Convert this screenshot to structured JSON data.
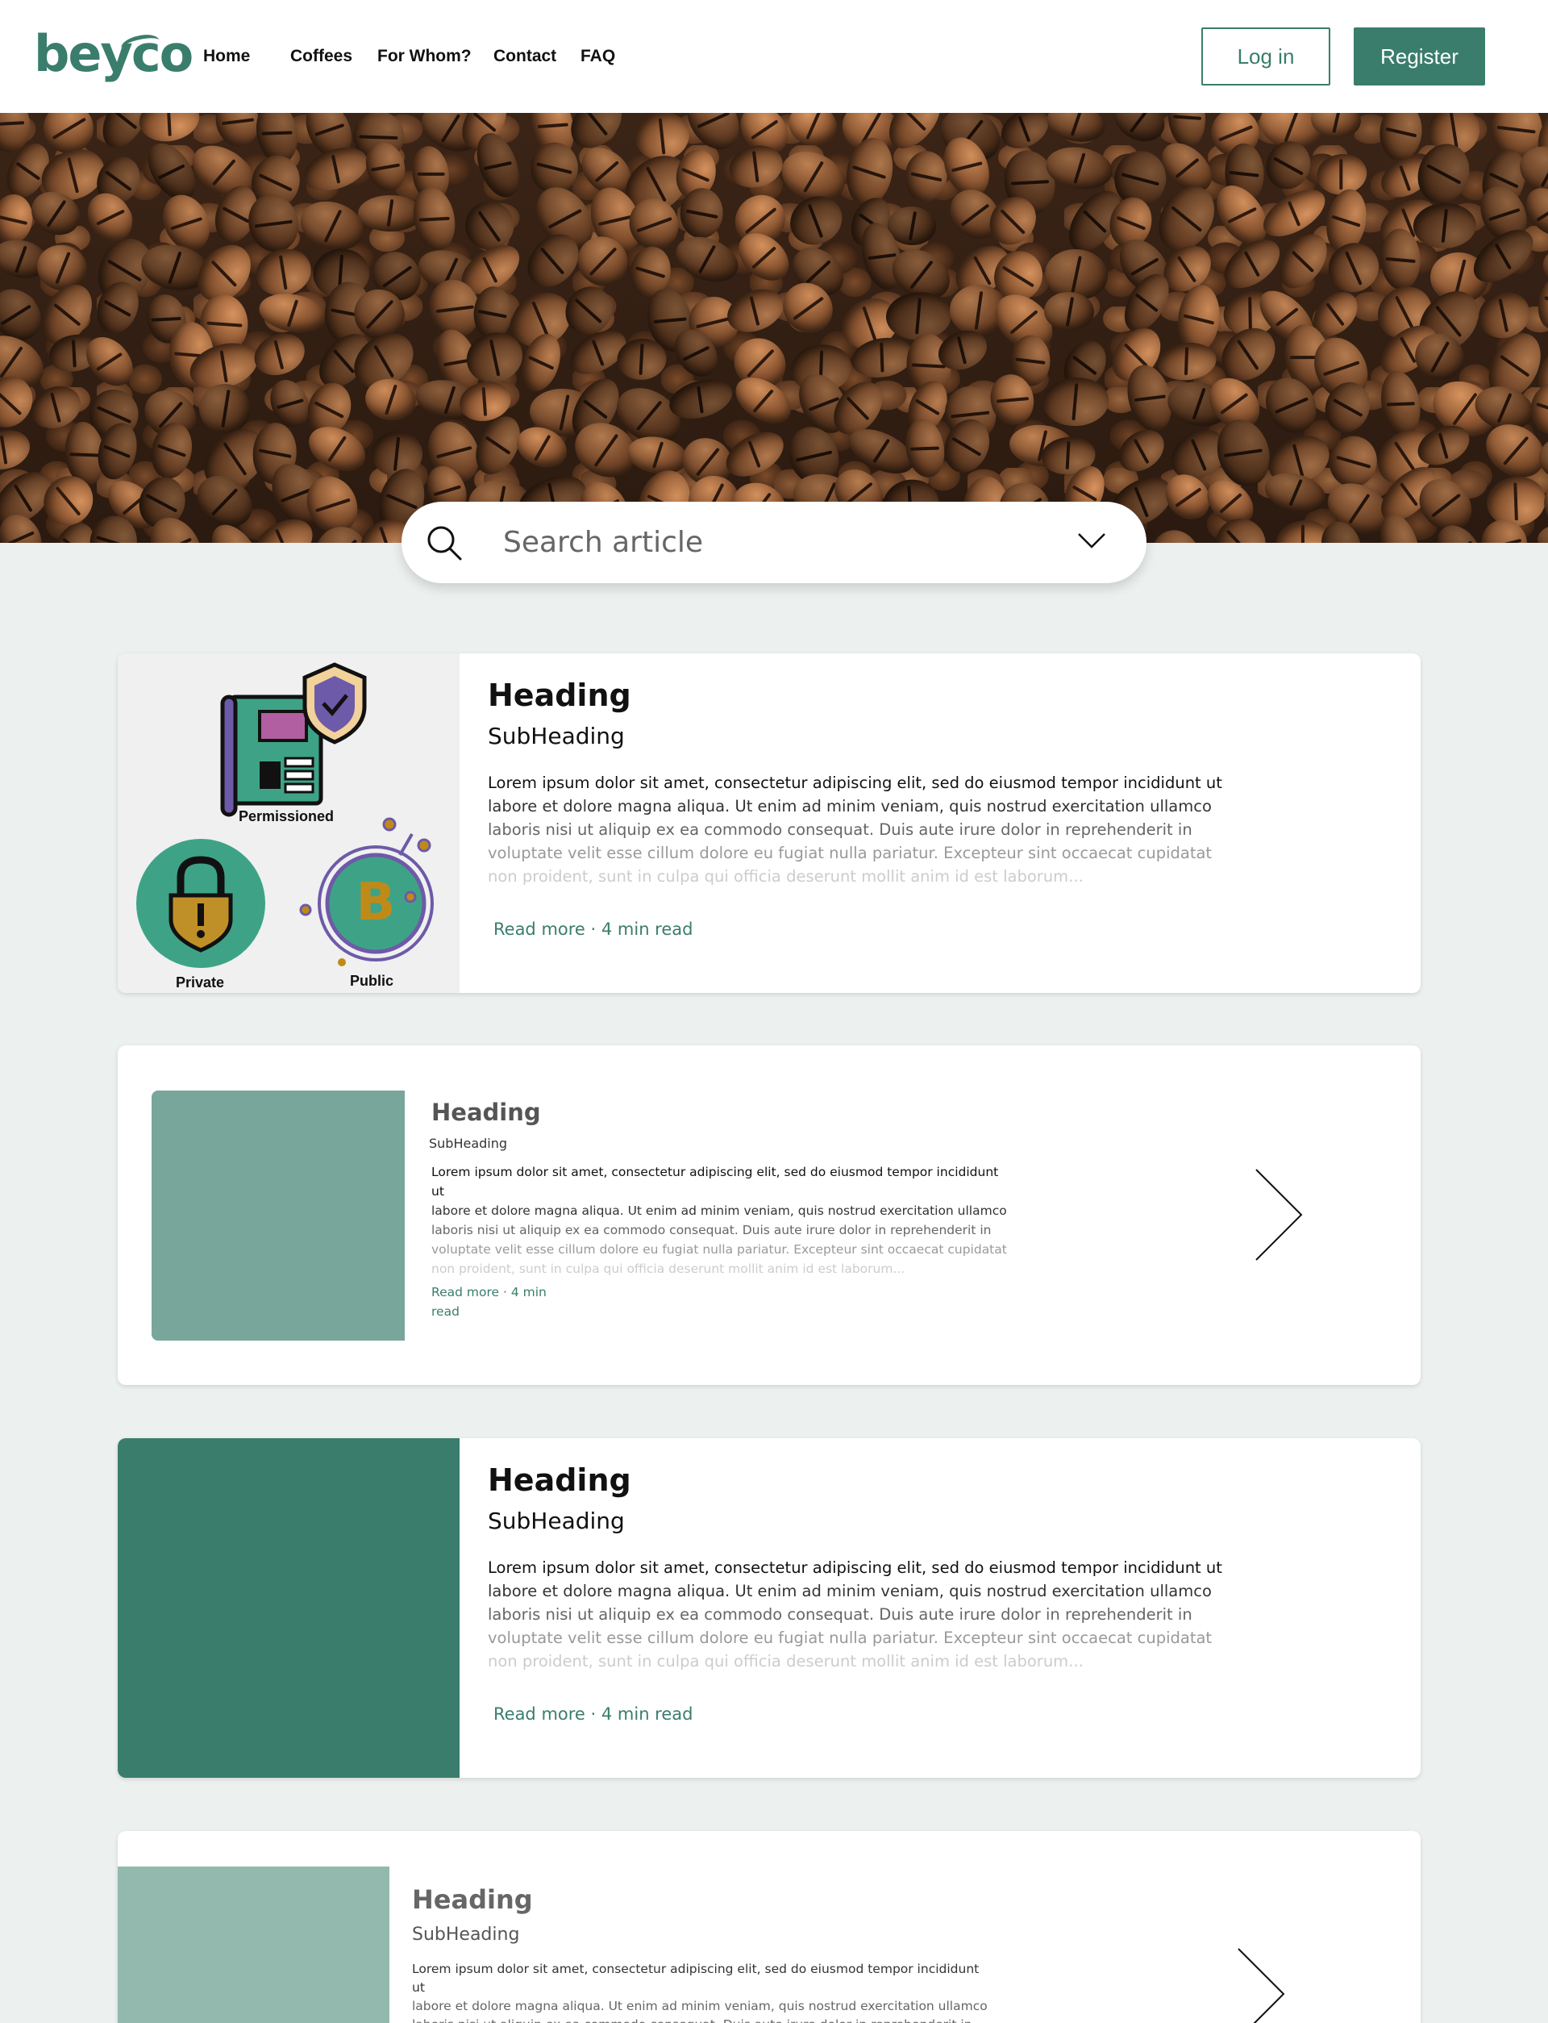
{
  "brand": {
    "logo": "beyco",
    "color": "#3a7d6c"
  },
  "nav": {
    "items": [
      "Home",
      "Coffees",
      "For Whom?",
      "Contact",
      "FAQ"
    ]
  },
  "auth": {
    "login": "Log in",
    "register": "Register"
  },
  "search": {
    "placeholder": "Search article"
  },
  "illustration": {
    "labels": [
      "Permissioned",
      "Private",
      "Public"
    ]
  },
  "articles": [
    {
      "heading": "Heading",
      "subheading": "SubHeading",
      "lines": [
        "Lorem ipsum dolor sit amet, consectetur adipiscing elit, sed do eiusmod tempor incididunt ut",
        "labore et dolore magna aliqua. Ut enim ad minim veniam, quis nostrud exercitation ullamco",
        "laboris nisi ut aliquip ex ea commodo consequat. Duis aute irure dolor in reprehenderit in",
        "voluptate velit esse cillum dolore eu fugiat nulla pariatur. Excepteur sint occaecat cupidatat",
        "non proident, sunt in culpa qui officia deserunt mollit anim id est laborum..."
      ],
      "read_more": "Read more",
      "read_time": "4 min read"
    },
    {
      "heading": "Heading",
      "subheading": "SubHeading",
      "lines": [
        "Lorem ipsum dolor sit amet, consectetur adipiscing elit, sed do eiusmod tempor incididunt ut",
        "labore et dolore magna aliqua. Ut enim ad minim veniam, quis nostrud exercitation ullamco",
        "laboris nisi ut aliquip ex ea commodo consequat. Duis aute irure dolor in reprehenderit in",
        "voluptate velit esse cillum dolore eu fugiat nulla pariatur. Excepteur sint occaecat cupidatat",
        "non proident, sunt in culpa qui officia deserunt mollit anim id est laborum..."
      ],
      "read_more": "Read more",
      "read_time_1": "4 min",
      "read_time_2": "read",
      "image_color": "#78a69a"
    },
    {
      "heading": "Heading",
      "subheading": "SubHeading",
      "lines": [
        "Lorem ipsum dolor sit amet, consectetur adipiscing elit, sed do eiusmod tempor incididunt ut",
        "labore et dolore magna aliqua. Ut enim ad minim veniam, quis nostrud exercitation ullamco",
        "laboris nisi ut aliquip ex ea commodo consequat. Duis aute irure dolor in reprehenderit in",
        "voluptate velit esse cillum dolore eu fugiat nulla pariatur. Excepteur sint occaecat cupidatat",
        "non proident, sunt in culpa qui officia deserunt mollit anim id est laborum..."
      ],
      "read_more": "Read more",
      "read_time": "4 min read",
      "image_color": "#3a7d6c"
    },
    {
      "heading": "Heading",
      "subheading": "SubHeading",
      "lines": [
        "Lorem ipsum dolor sit amet, consectetur adipiscing elit, sed do eiusmod tempor incididunt ut",
        "labore et dolore magna aliqua. Ut enim ad minim veniam, quis nostrud exercitation ullamco",
        "laboris nisi ut aliquip ex ea commodo consequat. Duis aute irure dolor in reprehenderit in"
      ],
      "image_color": "#93b9ae"
    }
  ]
}
